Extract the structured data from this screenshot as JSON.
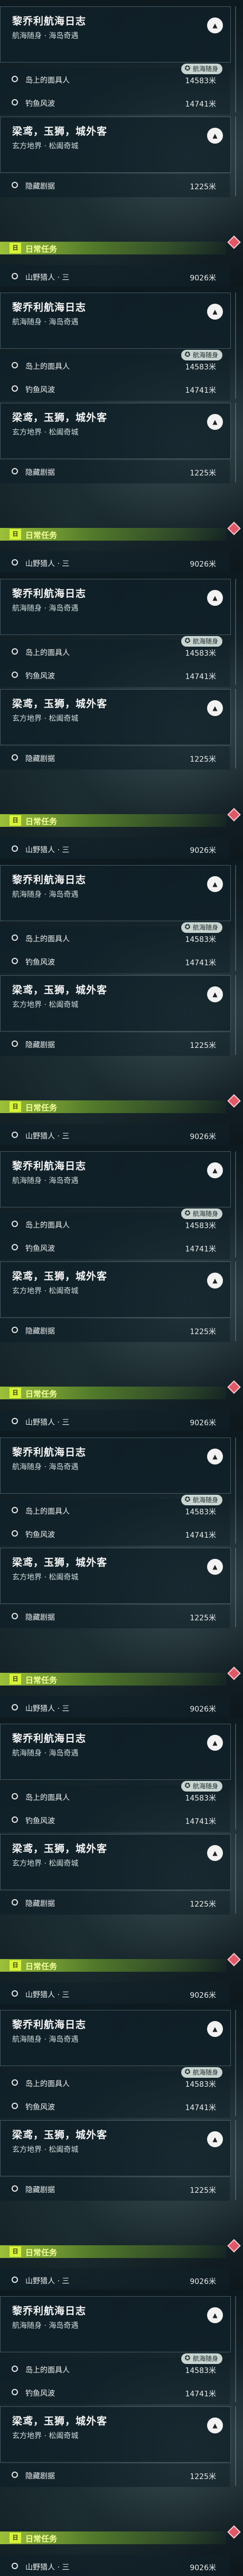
{
  "frames": [
    {
      "quest1": {
        "title": "黎乔利航海日志",
        "subtitle": "航海随身 · 海岛奇遇"
      },
      "objectives1": [
        {
          "label": "岛上的面具人",
          "distance": "14583米",
          "badge": "航海随身"
        },
        {
          "label": "钓鱼风波",
          "distance": "14741米",
          "badge": ""
        }
      ],
      "quest2": {
        "title": "梁鸢，玉狮，城外客",
        "subtitle": "玄方地界 · 松阖奇城"
      },
      "objective3": {
        "label": "隐藏剧据",
        "distance": "1225米"
      },
      "daily": {
        "icon_text": "日",
        "title": "日常任务"
      },
      "objective4": {
        "label": "山野猎人 · 三",
        "distance": "9026米"
      }
    },
    {
      "quest1": {
        "title": "黎乔利航海日志",
        "subtitle": "航海随身 · 海岛奇遇"
      },
      "objectives1": [
        {
          "label": "岛上的面具人",
          "distance": "14583米",
          "badge": "航海随身"
        },
        {
          "label": "钓鱼风波",
          "distance": "14741米",
          "badge": ""
        }
      ],
      "quest2": {
        "title": "梁鸢，玉狮，城外客",
        "subtitle": "玄方地界 · 松阖奇城"
      },
      "objective3": {
        "label": "隐藏剧据",
        "distance": "1225米"
      },
      "daily": {
        "icon_text": "日",
        "title": "日常任务"
      },
      "objective4": {
        "label": "山野猎人 · 三",
        "distance": "9026米"
      }
    },
    {
      "quest1": {
        "title": "黎乔利航海日志",
        "subtitle": "航海随身 · 海岛奇遇"
      },
      "objectives1": [
        {
          "label": "岛上的面具人",
          "distance": "14583米",
          "badge": "航海随身"
        },
        {
          "label": "钓鱼风波",
          "distance": "14741米",
          "badge": ""
        }
      ],
      "quest2": {
        "title": "梁鸢，玉狮，城外客",
        "subtitle": "玄方地界 · 松阖奇城"
      },
      "objective3": {
        "label": "隐藏剧据",
        "distance": "1225米"
      },
      "daily": {
        "icon_text": "日",
        "title": "日常任务"
      },
      "objective4": {
        "label": "山野猎人 · 三",
        "distance": "9026米"
      }
    },
    {
      "quest1": {
        "title": "黎乔利航海日志",
        "subtitle": "航海随身 · 海岛奇遇"
      },
      "objectives1": [
        {
          "label": "岛上的面具人",
          "distance": "14583米",
          "badge": "航海随身"
        },
        {
          "label": "钓鱼风波",
          "distance": "14741米",
          "badge": ""
        }
      ],
      "quest2": {
        "title": "梁鸢，玉狮，城外客",
        "subtitle": "玄方地界 · 松阖奇城"
      },
      "objective3": {
        "label": "隐藏剧据",
        "distance": "1225米"
      },
      "daily": {
        "icon_text": "日",
        "title": "日常任务"
      },
      "objective4": {
        "label": "山野猎人 · 三",
        "distance": "9026米"
      }
    },
    {
      "quest1": {
        "title": "黎乔利航海日志",
        "subtitle": "航海随身 · 海岛奇遇"
      },
      "objectives1": [
        {
          "label": "岛上的面具人",
          "distance": "14583米",
          "badge": "航海随身"
        },
        {
          "label": "钓鱼风波",
          "distance": "14741米",
          "badge": ""
        }
      ],
      "quest2": {
        "title": "梁鸢，玉狮，城外客",
        "subtitle": "玄方地界 · 松阖奇城"
      },
      "objective3": {
        "label": "隐藏剧据",
        "distance": "1225米"
      },
      "daily": {
        "icon_text": "日",
        "title": "日常任务"
      },
      "objective4": {
        "label": "山野猎人 · 三",
        "distance": "9026米"
      }
    },
    {
      "quest1": {
        "title": "黎乔利航海日志",
        "subtitle": "航海随身 · 海岛奇遇"
      },
      "objectives1": [
        {
          "label": "岛上的面具人",
          "distance": "14583米",
          "badge": "航海随身"
        },
        {
          "label": "钓鱼风波",
          "distance": "14741米",
          "badge": ""
        }
      ],
      "quest2": {
        "title": "梁鸢，玉狮，城外客",
        "subtitle": "玄方地界 · 松阖奇城"
      },
      "objective3": {
        "label": "隐藏剧据",
        "distance": "1225米"
      },
      "daily": {
        "icon_text": "日",
        "title": "日常任务"
      },
      "objective4": {
        "label": "山野猎人 · 三",
        "distance": "9026米"
      }
    },
    {
      "quest1": {
        "title": "黎乔利航海日志",
        "subtitle": "航海随身 · 海岛奇遇"
      },
      "objectives1": [
        {
          "label": "岛上的面具人",
          "distance": "14583米",
          "badge": "航海随身"
        },
        {
          "label": "钓鱼风波",
          "distance": "14741米",
          "badge": ""
        }
      ],
      "quest2": {
        "title": "梁鸢，玉狮，城外客",
        "subtitle": "玄方地界 · 松阖奇城"
      },
      "objective3": {
        "label": "隐藏剧据",
        "distance": "1225米"
      },
      "daily": {
        "icon_text": "日",
        "title": "日常任务"
      },
      "objective4": {
        "label": "山野猎人 · 三",
        "distance": "9026米"
      }
    },
    {
      "quest1": {
        "title": "黎乔利航海日志",
        "subtitle": "航海随身 · 海岛奇遇"
      },
      "objectives1": [
        {
          "label": "岛上的面具人",
          "distance": "14583米",
          "badge": "航海随身"
        },
        {
          "label": "钓鱼风波",
          "distance": "14741米",
          "badge": ""
        }
      ],
      "quest2": {
        "title": "梁鸢，玉狮，城外客",
        "subtitle": "玄方地界 · 松阖奇城"
      },
      "objective3": {
        "label": "隐藏剧据",
        "distance": "1225米"
      },
      "daily": {
        "icon_text": "日",
        "title": "日常任务"
      },
      "objective4": {
        "label": "山野猎人 · 三",
        "distance": "9026米"
      }
    },
    {
      "quest1": {
        "title": "黎乔利航海日志",
        "subtitle": "航海随身 · 海岛奇遇"
      },
      "objectives1": [
        {
          "label": "岛上的面具人",
          "distance": "14583米",
          "badge": "航海随身"
        },
        {
          "label": "钓鱼风波",
          "distance": "14741米",
          "badge": ""
        }
      ],
      "quest2": {
        "title": "梁鸢，玉狮，城外客",
        "subtitle": "玄方地界 · 松阖奇城"
      },
      "objective3": {
        "label": "隐藏剧据",
        "distance": "1225米"
      },
      "daily": {
        "icon_text": "日",
        "title": "日常任务"
      },
      "objective4": {
        "label": "山野猎人 · 三",
        "distance": "9026米"
      }
    }
  ]
}
